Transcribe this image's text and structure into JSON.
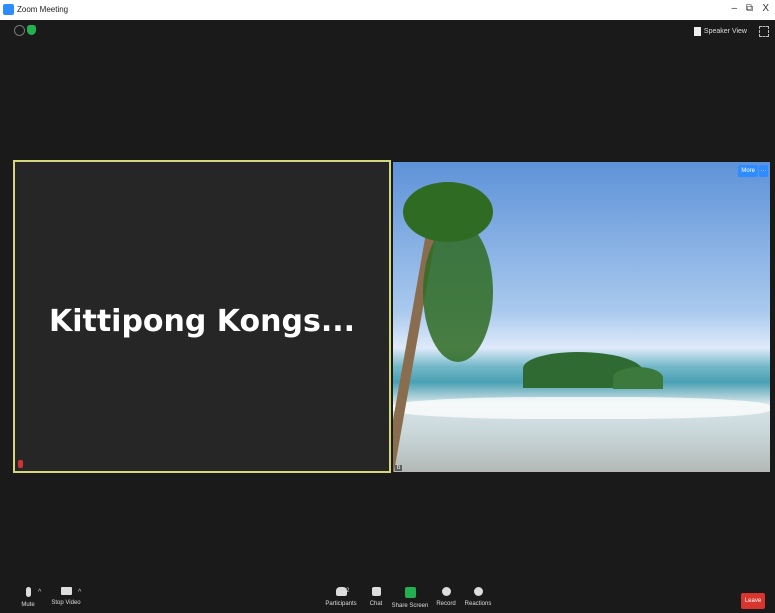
{
  "window": {
    "title": "Zoom Meeting",
    "minimize": "–",
    "maximize": "⧉",
    "close": "X"
  },
  "header": {
    "speaker_view_label": "Speaker View"
  },
  "participants": {
    "left": {
      "name": "Kittipong  Kongs..."
    },
    "right": {
      "more_label": "More",
      "dots_label": "···",
      "name_label": "b"
    }
  },
  "toolbar": {
    "mute": "Mute",
    "stop_video": "Stop Video",
    "participants": "Participants",
    "participants_count": "2",
    "chat": "Chat",
    "share_screen": "Share Screen",
    "record": "Record",
    "reactions": "Reactions",
    "leave": "Leave"
  },
  "colors": {
    "active_speaker_border": "#d2d77a",
    "share": "#23b04f",
    "leave": "#d9352f",
    "accent": "#2d8cff"
  }
}
